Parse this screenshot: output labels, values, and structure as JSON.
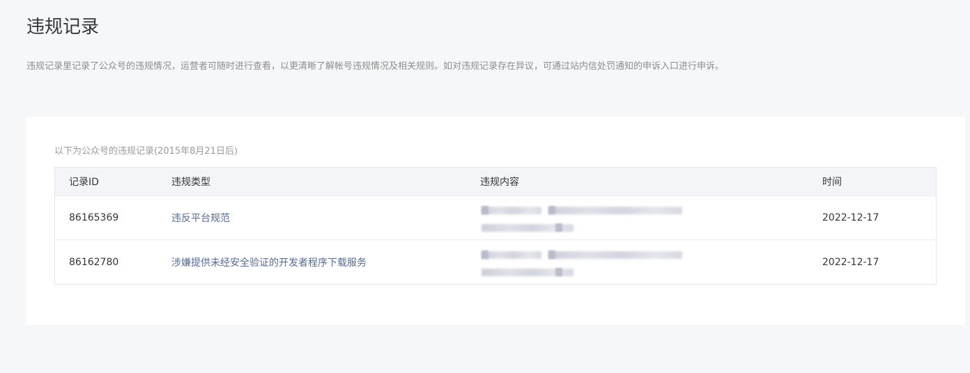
{
  "page": {
    "title": "违规记录",
    "description": "违规记录里记录了公众号的违规情况，运营者可随时进行查看，以更清晰了解帐号违规情况及相关规则。如对违规记录存在异议，可通过站内信处罚通知的申诉入口进行申诉。"
  },
  "records": {
    "caption": "以下为公众号的违规记录(2015年8月21日后)",
    "columns": {
      "id": "记录ID",
      "type": "违规类型",
      "content": "违规内容",
      "time": "时间"
    },
    "rows": [
      {
        "id": "86165369",
        "type": "违反平台规范",
        "time": "2022-12-17"
      },
      {
        "id": "86162780",
        "type": "涉嫌提供未经安全验证的开发者程序下载服务",
        "time": "2022-12-17"
      }
    ]
  }
}
